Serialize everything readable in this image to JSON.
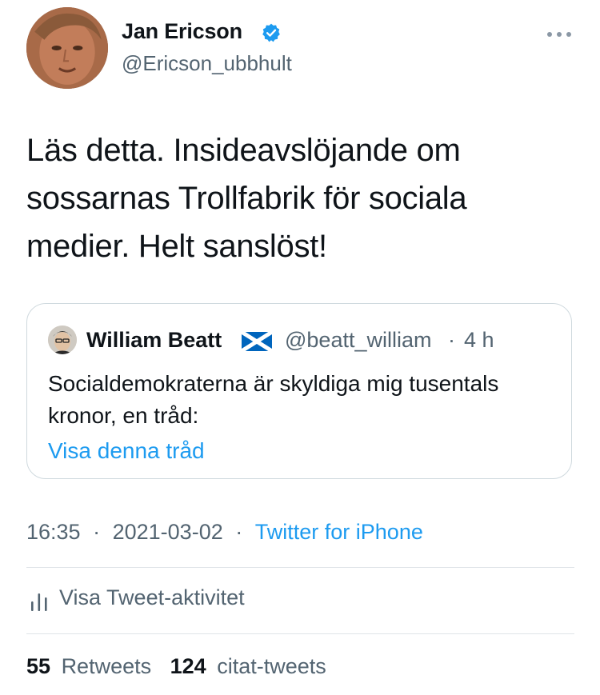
{
  "tweet": {
    "author": {
      "name": "Jan Ericson",
      "handle": "@Ericson_ubbhult",
      "verified": true
    },
    "text": "Läs detta. Insideavslöjande om sossarnas Trollfabrik för sociala medier. Helt sanslöst!",
    "quoted": {
      "name": "William Beatt",
      "flag_icon": "scotland-flag-icon",
      "handle": "@beatt_william",
      "separator": "·",
      "time": "4 h",
      "text": "Socialdemokraterna är skyldiga mig tusentals kronor, en tråd:",
      "link": "Visa denna tråd"
    },
    "meta": {
      "time": "16:35",
      "sep1": "·",
      "date": "2021-03-02",
      "sep2": "·",
      "source": "Twitter for iPhone"
    },
    "activity_label": "Visa Tweet-aktivitet",
    "stats": {
      "retweets_count": "55",
      "retweets_label": "Retweets",
      "quotes_count": "124",
      "quotes_label": "citat-tweets"
    }
  },
  "colors": {
    "text": "#0f1419",
    "secondary": "#536471",
    "link": "#1d9bf0",
    "border": "#cfd9de",
    "verified": "#1d9bf0"
  }
}
